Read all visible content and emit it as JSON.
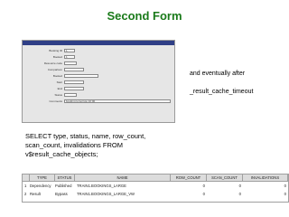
{
  "slide": {
    "title": "Second Form",
    "note_line1": "and eventually after",
    "note_line2": "_result_cache_timeout",
    "sql": "SELECT type, status, name, row_count, scan_count, invalidations FROM v$result_cache_objects;"
  },
  "form": {
    "fields": [
      {
        "label": "Booking ID",
        "value": "1"
      },
      {
        "label": "Booked",
        "value": "1"
      },
      {
        "label": "Resource code",
        "value": ""
      },
      {
        "label": "Comparison",
        "value": ""
      },
      {
        "label": "Booked",
        "value": ""
      },
      {
        "label": "Start",
        "value": ""
      },
      {
        "label": "End",
        "value": ""
      },
      {
        "label": "Status",
        "value": ""
      },
      {
        "label": "Comments",
        "value": "booking tomorrow 10:00"
      }
    ]
  },
  "grid": {
    "columns": [
      "TYPE",
      "STATUS",
      "NAME",
      "ROW_COUNT",
      "SCAN_COUNT",
      "INVALIDATIONS"
    ],
    "rows": [
      {
        "num": "1",
        "type": "Dependency",
        "status": "Published",
        "name": "TRAIN1.BOOKINGS_LARGE",
        "row_count": "0",
        "scan_count": "0",
        "invalidations": "0"
      },
      {
        "num": "2",
        "type": "Result",
        "status": "Bypass",
        "name": "TRAIN1.BOOKINGS_LARGE_VW",
        "row_count": "0",
        "scan_count": "0",
        "invalidations": "0"
      }
    ]
  }
}
